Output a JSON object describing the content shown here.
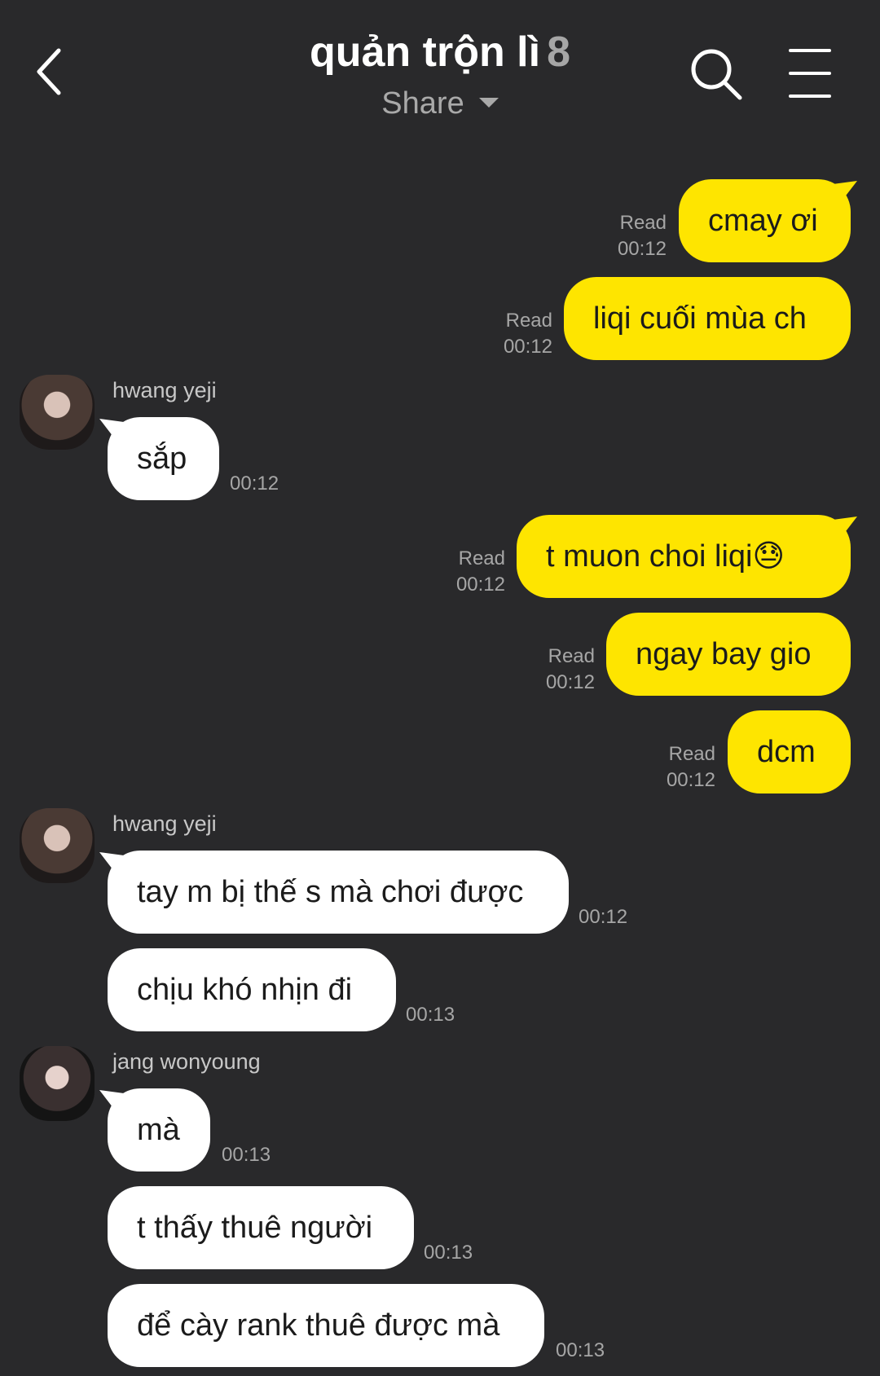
{
  "header": {
    "title": "quản trộn lì",
    "member_count": "8",
    "subtitle": "Share"
  },
  "messages": [
    {
      "text": "cmay ơi",
      "read": "Read",
      "time": "00:12"
    },
    {
      "text": "liqi cuối mùa ch",
      "read": "Read",
      "time": "00:12"
    },
    {
      "sender": "hwang yeji",
      "text": "sắp",
      "time": "00:12"
    },
    {
      "text": "t muon choi liqi😓",
      "read": "Read",
      "time": "00:12"
    },
    {
      "text": "ngay bay gio",
      "read": "Read",
      "time": "00:12"
    },
    {
      "text": "dcm",
      "read": "Read",
      "time": "00:12"
    },
    {
      "sender": "hwang yeji",
      "text": "tay m bị thế s mà chơi được",
      "time": "00:12"
    },
    {
      "text": "chịu khó nhịn đi",
      "time": "00:13"
    },
    {
      "sender": "jang wonyoung",
      "text": "mà",
      "time": "00:13"
    },
    {
      "text": "t thấy thuê người",
      "time": "00:13"
    },
    {
      "text": "để cày rank thuê được mà",
      "time": "00:13"
    }
  ],
  "colors": {
    "background": "#29292b",
    "outgoing_bubble": "#fee500",
    "incoming_bubble": "#ffffff"
  }
}
